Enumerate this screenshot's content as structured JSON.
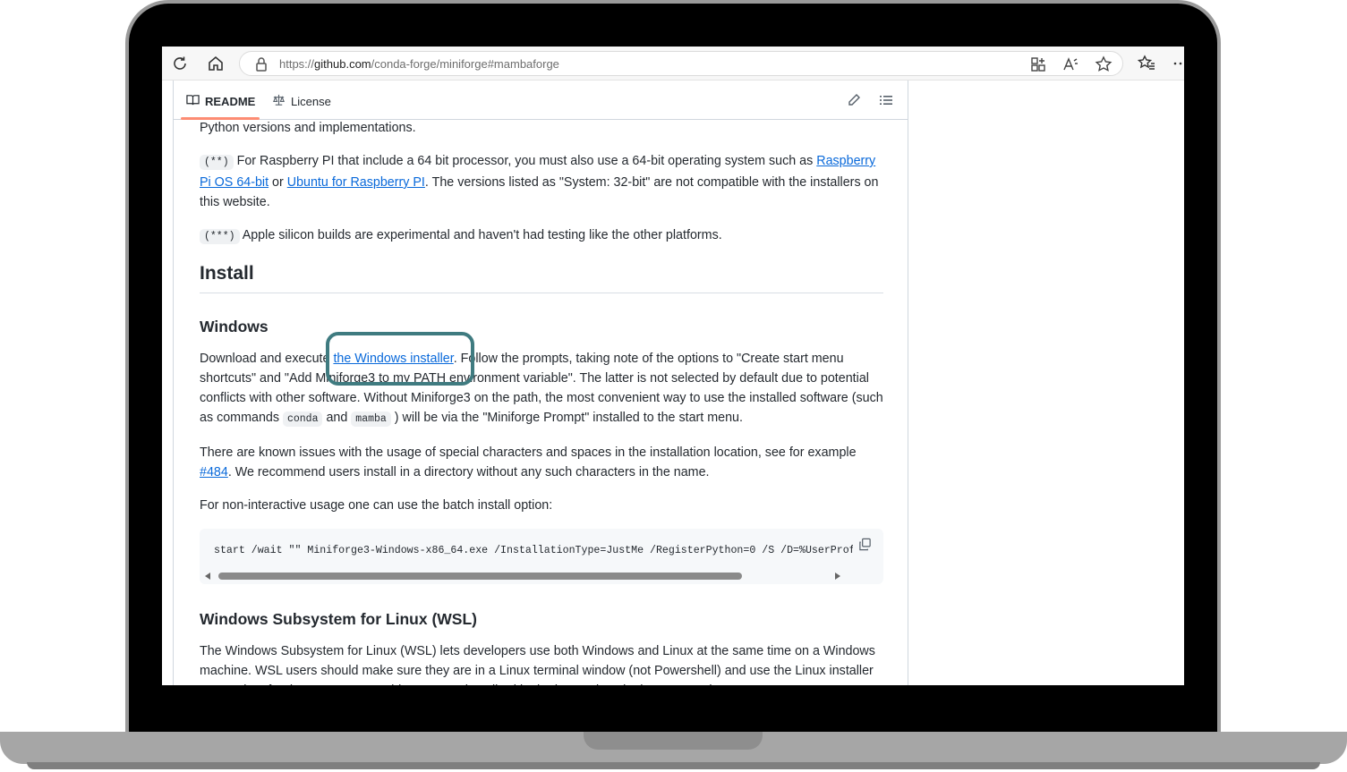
{
  "browser": {
    "url_scheme": "https://",
    "url_host": "github.com",
    "url_path": "/conda-forge/miniforge#mambaforge"
  },
  "tabs": {
    "readme": "README",
    "license": "License"
  },
  "content": {
    "p0": "Python versions and implementations.",
    "p1_code": "(**)",
    "p1_text_a": " For Raspberry PI that include a 64 bit processor, you must also use a 64-bit operating system such as ",
    "p1_link1": "Raspberry Pi OS 64-bit",
    "p1_text_b": " or ",
    "p1_link2": "Ubuntu for Raspberry PI",
    "p1_text_c": ". The versions listed as \"System: 32-bit\" are not compatible with the installers on this website.",
    "p2_code": "(***)",
    "p2_text": " Apple silicon builds are experimental and haven't had testing like the other platforms.",
    "h_install": "Install",
    "h_windows": "Windows",
    "p3_text_a": "Download and execute ",
    "p3_link": "the Windows installer",
    "p3_text_b": ". Follow the prompts, taking note of the options to \"Create start menu shortcuts\" and \"Add Miniforge3 to my PATH environment variable\". The latter is not selected by default due to potential conflicts with other software. Without Miniforge3 on the path, the most convenient way to use the installed software (such as commands ",
    "p3_code1": "conda",
    "p3_text_c": " and ",
    "p3_code2": "mamba",
    "p3_text_d": " ) will be via the \"Miniforge Prompt\" installed to the start menu.",
    "p4_text_a": "There are known issues with the usage of special characters and spaces in the installation location, see for example ",
    "p4_link": "#484",
    "p4_text_b": ". We recommend users install in a directory without any such characters in the name.",
    "p5": "For non-interactive usage one can use the batch install option:",
    "code_block": "start /wait \"\" Miniforge3-Windows-x86_64.exe /InstallationType=JustMe /RegisterPython=0 /S /D=%UserProf",
    "h_wsl": "Windows Subsystem for Linux (WSL)",
    "p6": "The Windows Subsystem for Linux (WSL) lets developers use both Windows and Linux at the same time on a Windows machine. WSL users should make sure they are in a Linux terminal window (not Powershell) and use the Linux installer appropriate for the computer's architecture as described in the instructions in the next section."
  },
  "colors": {
    "link": "#0969da",
    "highlight_border": "#3f7b80",
    "tab_underline": "#fd8c73"
  }
}
